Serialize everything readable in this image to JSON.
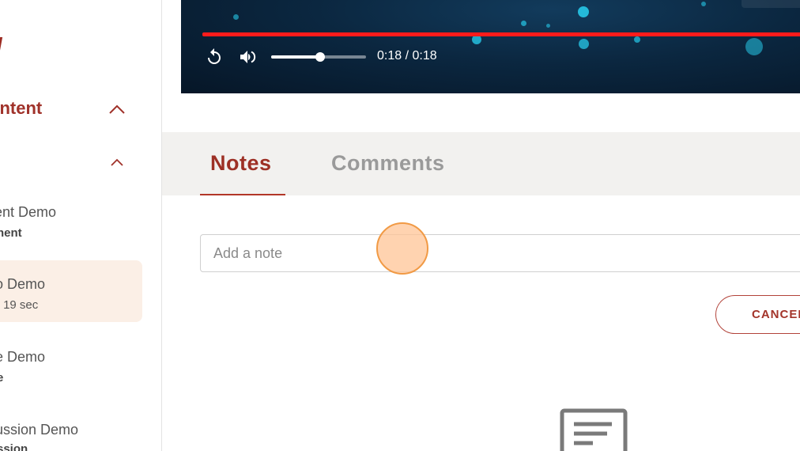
{
  "sidebar": {
    "fragment_text": "/",
    "section_heading": "ontent",
    "items": [
      {
        "title": "ment Demo",
        "subtitle": "nent",
        "subtitle_bold": true
      },
      {
        "title": "o Demo",
        "subtitle": "| 19 sec",
        "subtitle_bold": false,
        "active": true
      },
      {
        "title": "e Demo",
        "subtitle": "e",
        "subtitle_bold": true
      },
      {
        "title": "ussion Demo",
        "subtitle": "ssion",
        "subtitle_bold": true
      }
    ]
  },
  "video": {
    "time_display": "0:18 / 0:18",
    "progress_fraction": 1.0,
    "volume_fraction": 0.52,
    "icons": [
      "replay-icon",
      "volume-icon"
    ],
    "progress_color": "#ff1b1b"
  },
  "tabs": [
    {
      "label": "Notes",
      "active": true
    },
    {
      "label": "Comments",
      "active": false
    }
  ],
  "note": {
    "placeholder": "Add a note",
    "value": ""
  },
  "buttons": {
    "cancel_label": "CANCEL"
  },
  "colors": {
    "accent": "#9d3025",
    "tab_bar_bg": "#f2f1ef",
    "active_item_bg": "#fbefe6"
  }
}
